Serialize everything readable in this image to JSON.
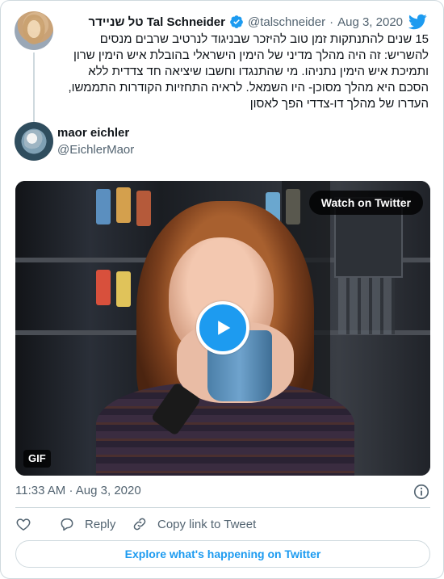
{
  "parent_tweet": {
    "display_name": "טל שניידר Tal Schneider",
    "handle": "@talschneider",
    "date": "Aug 3, 2020",
    "text": "15 שנים להתנתקות זמן טוב להיזכר שבניגוד לנרטיב שרבים מנסים להשריש: זה היה מהלך מדיני של הימין הישראלי בהובלת איש הימין שרון ותמיכת איש הימין נתניהו. מי שהתנגדו וחשבו שיציאה חד צדדית ללא הסכם היא מהלך מסוכן- היו השמאל. לראיה התחזיות הקודרות התממשו, העדרו של מהלך דו-צדדי הפך לאסון",
    "separator": "·"
  },
  "author": {
    "display_name": "maor eichler",
    "handle": "@EichlerMaor"
  },
  "media": {
    "watch_label": "Watch on Twitter",
    "gif_label": "GIF"
  },
  "footer": {
    "time": "11:33 AM",
    "date": "Aug 3, 2020",
    "separator": "·",
    "reply_label": "Reply",
    "copy_link_label": "Copy link to Tweet",
    "explore_label": "Explore what's happening on Twitter"
  },
  "colors": {
    "accent": "#1d9bf0",
    "text_primary": "#0f1419",
    "text_secondary": "#536471",
    "border": "#cfd9de"
  },
  "icons": [
    "twitter-bird-icon",
    "verified-badge-icon",
    "play-icon",
    "info-icon",
    "heart-icon",
    "reply-icon",
    "link-icon"
  ]
}
